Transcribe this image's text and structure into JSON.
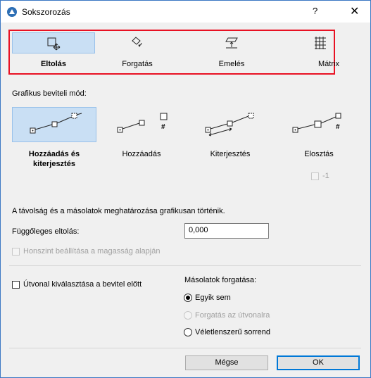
{
  "window": {
    "title": "Sokszorozás",
    "help": "?",
    "close": "✕"
  },
  "modes": [
    {
      "label": "Eltolás",
      "icon": "move-icon"
    },
    {
      "label": "Forgatás",
      "icon": "rotate-icon"
    },
    {
      "label": "Emelés",
      "icon": "elevate-icon"
    },
    {
      "label": "Mátrix",
      "icon": "matrix-icon"
    }
  ],
  "input_mode": {
    "label": "Grafikus beviteli mód:",
    "methods": [
      {
        "label": "Hozzáadás és kiterjesztés",
        "icon": "add-and-extend-icon"
      },
      {
        "label": "Hozzáadás",
        "icon": "add-icon",
        "sign": "#"
      },
      {
        "label": "Kiterjesztés",
        "icon": "extend-icon"
      },
      {
        "label": "Elosztás",
        "icon": "distribute-icon",
        "sign": "#"
      }
    ],
    "minus_one_label": "-1"
  },
  "info_text": "A távolság és a másolatok meghatározása grafikusan történik.",
  "vertical_offset": {
    "label": "Függőleges eltolás:",
    "value": "0,000"
  },
  "story_checkbox": "Honszint beállítása a magasság alapján",
  "path_checkbox": "Útvonal kiválasztása a bevitel előtt",
  "rotation": {
    "label": "Másolatok forgatása:",
    "options": [
      "Egyik sem",
      "Forgatás az útvonalra",
      "Véletlenszerű sorrend"
    ]
  },
  "buttons": {
    "cancel": "Mégse",
    "ok": "OK"
  },
  "colors": {
    "highlight": "#e81123",
    "selection": "#c9dff4",
    "accent": "#0078d7"
  }
}
